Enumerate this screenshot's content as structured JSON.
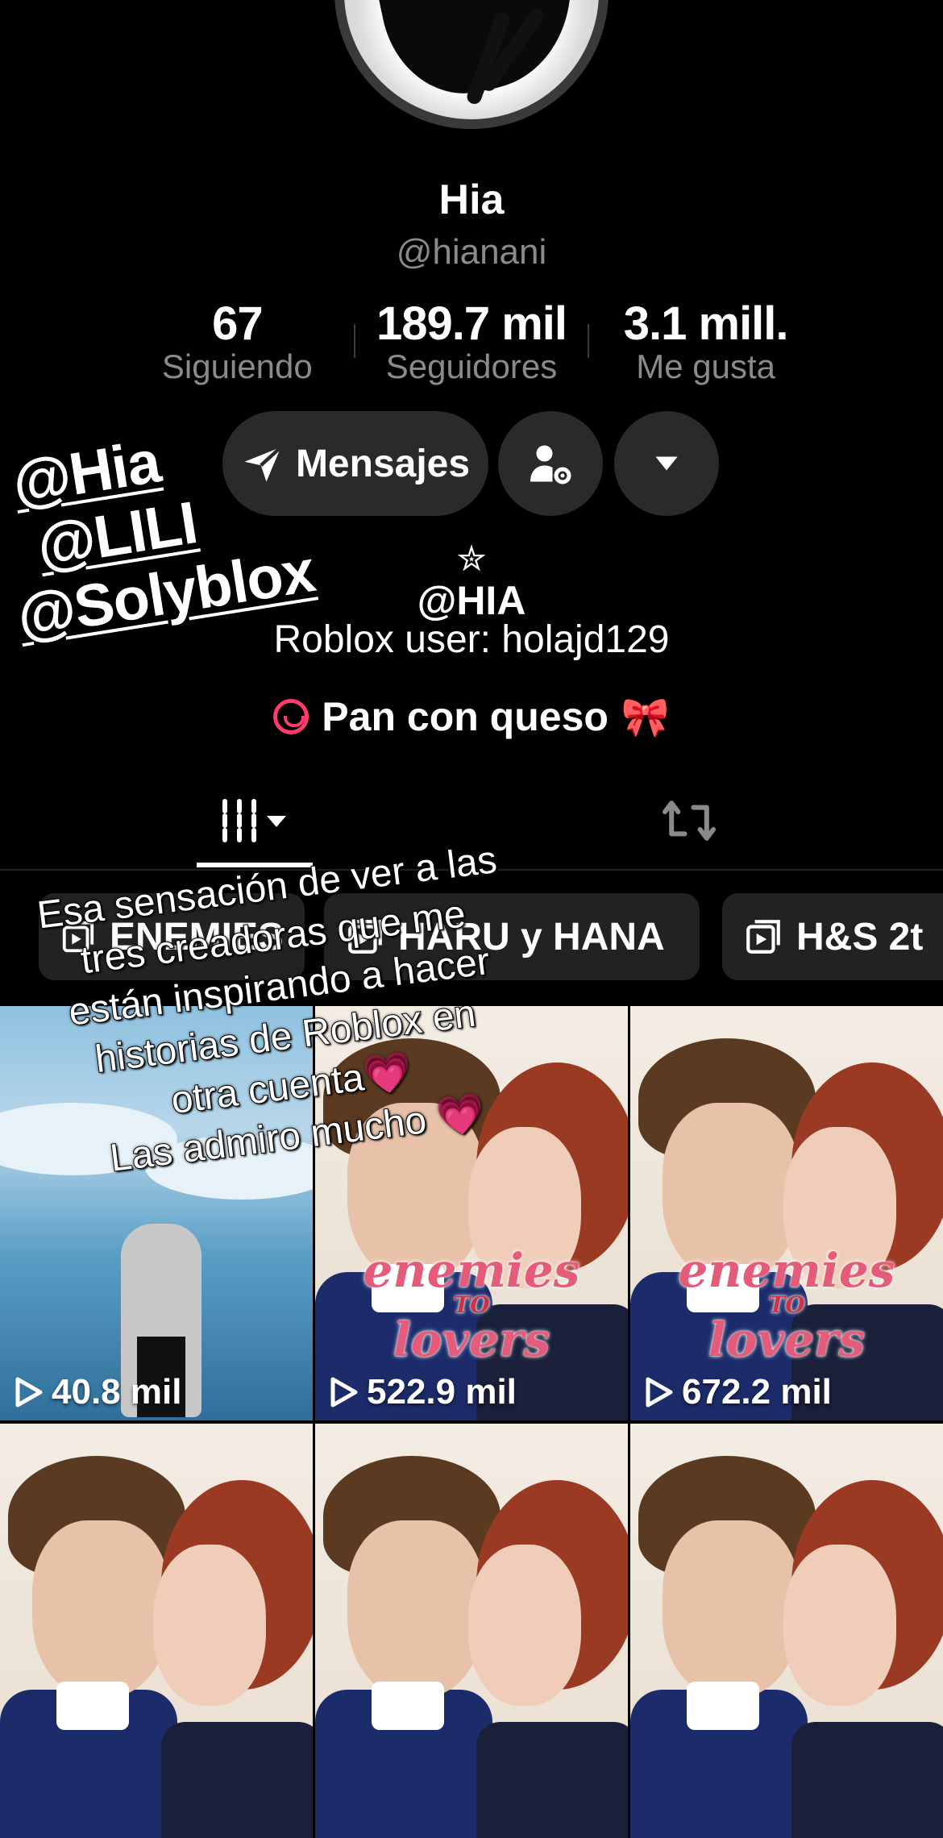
{
  "profile": {
    "name": "Hia",
    "handle": "@hianani"
  },
  "stats": [
    {
      "value": "67",
      "label": "Siguiendo"
    },
    {
      "value": "189.7 mil",
      "label": "Seguidores"
    },
    {
      "value": "3.1 mill.",
      "label": "Me gusta"
    }
  ],
  "actions": {
    "message_label": "Mensajes",
    "message_icon": "send-icon",
    "user_settings_icon": "user-gear-icon",
    "dropdown_icon": "chevron-down-icon"
  },
  "bio": {
    "star": "✮",
    "line1": "@HIA",
    "line2": "Roblox user: holajd129",
    "link_text": "Pan con queso",
    "link_emoji": "🎀"
  },
  "tabs": {
    "videos_icon": "grid-icon",
    "reposts_icon": "repost-icon"
  },
  "playlists": [
    "ENEMIES",
    "HARU y HANA",
    "H&S 2t"
  ],
  "videos": [
    {
      "views": "40.8 mil",
      "type": "roblox"
    },
    {
      "views": "522.9 mil",
      "type": "cover"
    },
    {
      "views": "672.2 mil",
      "type": "cover"
    },
    {
      "views": "",
      "type": "cover"
    },
    {
      "views": "",
      "type": "cover"
    },
    {
      "views": "",
      "type": "cover"
    }
  ],
  "cover_title": {
    "top": "enemies",
    "to": "TO",
    "bottom": "lovers"
  },
  "sticker_mentions": [
    "@Hia",
    "@LILI",
    "@Solyblox"
  ],
  "overlay_caption": [
    "Esa sensación de ver a las",
    "tres creadoras que me",
    "están inspirando a hacer",
    "historias de Roblox en",
    "otra cuenta💗",
    "Las admiro mucho 💗"
  ]
}
